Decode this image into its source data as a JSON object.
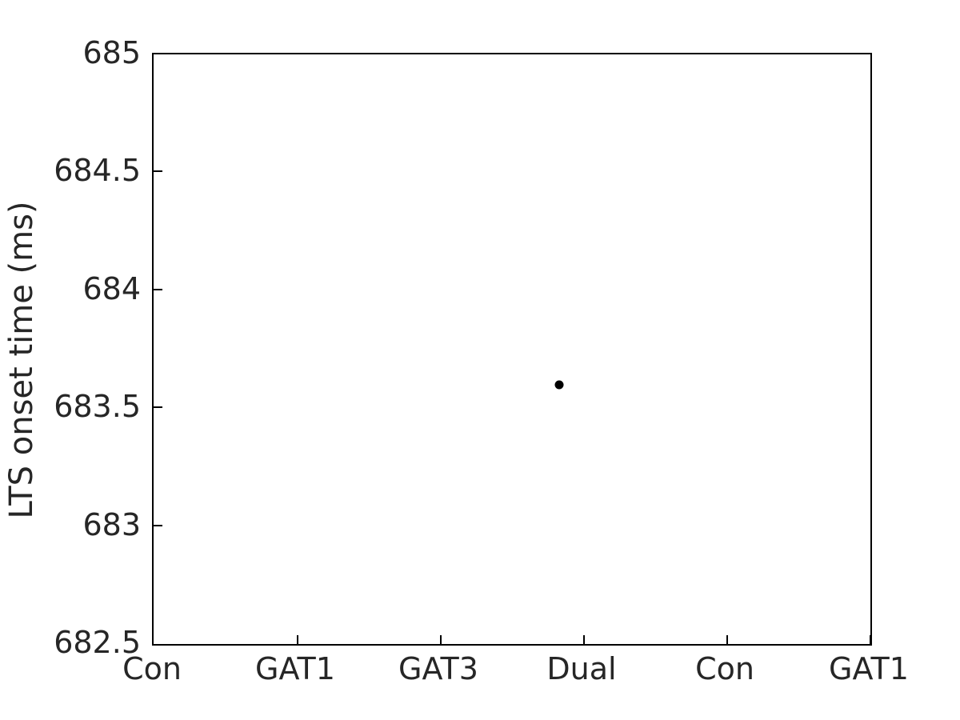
{
  "chart_data": {
    "type": "scatter",
    "title": "",
    "xlabel": "",
    "ylabel": "LTS onset time (ms)",
    "categories": [
      "Con",
      "GAT1",
      "GAT3",
      "Dual",
      "Con",
      "GAT1"
    ],
    "xtick_labels": [
      "Con",
      "GAT1",
      "GAT3",
      "Dual",
      "Con",
      "GAT1"
    ],
    "xtick_positions": [
      0,
      1,
      2,
      3,
      4,
      5
    ],
    "xlim": [
      0,
      5
    ],
    "ytick_labels": [
      "685",
      "684.5",
      "684",
      "683.5",
      "683",
      "682.5"
    ],
    "ytick_values": [
      685,
      684.5,
      684,
      683.5,
      683,
      682.5
    ],
    "ylim": [
      682.5,
      685
    ],
    "grid": false,
    "legend": null,
    "series": [
      {
        "name": "LTS onset time",
        "marker": "filled-circle",
        "color": "#000000",
        "points": [
          {
            "x": 2.83,
            "y": 683.6,
            "category": "Dual"
          }
        ]
      }
    ],
    "axis_color": "#000000",
    "text_color": "#262626",
    "background_color": "#ffffff"
  }
}
